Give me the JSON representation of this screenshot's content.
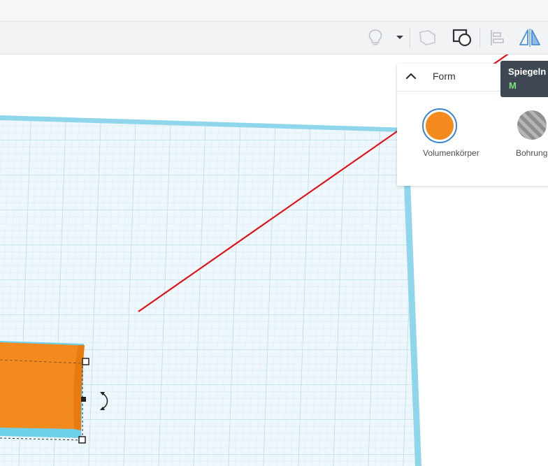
{
  "toolbar": {
    "buttons": [
      {
        "name": "notes-lightbulb",
        "icon": "lightbulb-icon"
      },
      {
        "name": "notes-dropdown",
        "icon": "caret-down-icon"
      },
      {
        "name": "show-all",
        "icon": "cube-outline-icon"
      },
      {
        "name": "group",
        "icon": "group-shapes-icon"
      },
      {
        "name": "align",
        "icon": "align-icon"
      },
      {
        "name": "mirror",
        "icon": "mirror-icon"
      }
    ]
  },
  "shape_panel": {
    "title": "Form",
    "options": [
      {
        "label": "Volumenkörper",
        "color": "#f28a1d",
        "selected": true
      },
      {
        "label": "Bohrung",
        "color": "#9a9a9a",
        "selected": false
      }
    ]
  },
  "tooltip": {
    "title": "Spiegeln",
    "shortcut": "M"
  },
  "colors": {
    "accent": "#3b82d0",
    "shape_orange": "#f28a1d",
    "workplane": "#eef7fb",
    "workplane_border": "#6fd0ea",
    "annotation_arrow": "#e0131a"
  }
}
